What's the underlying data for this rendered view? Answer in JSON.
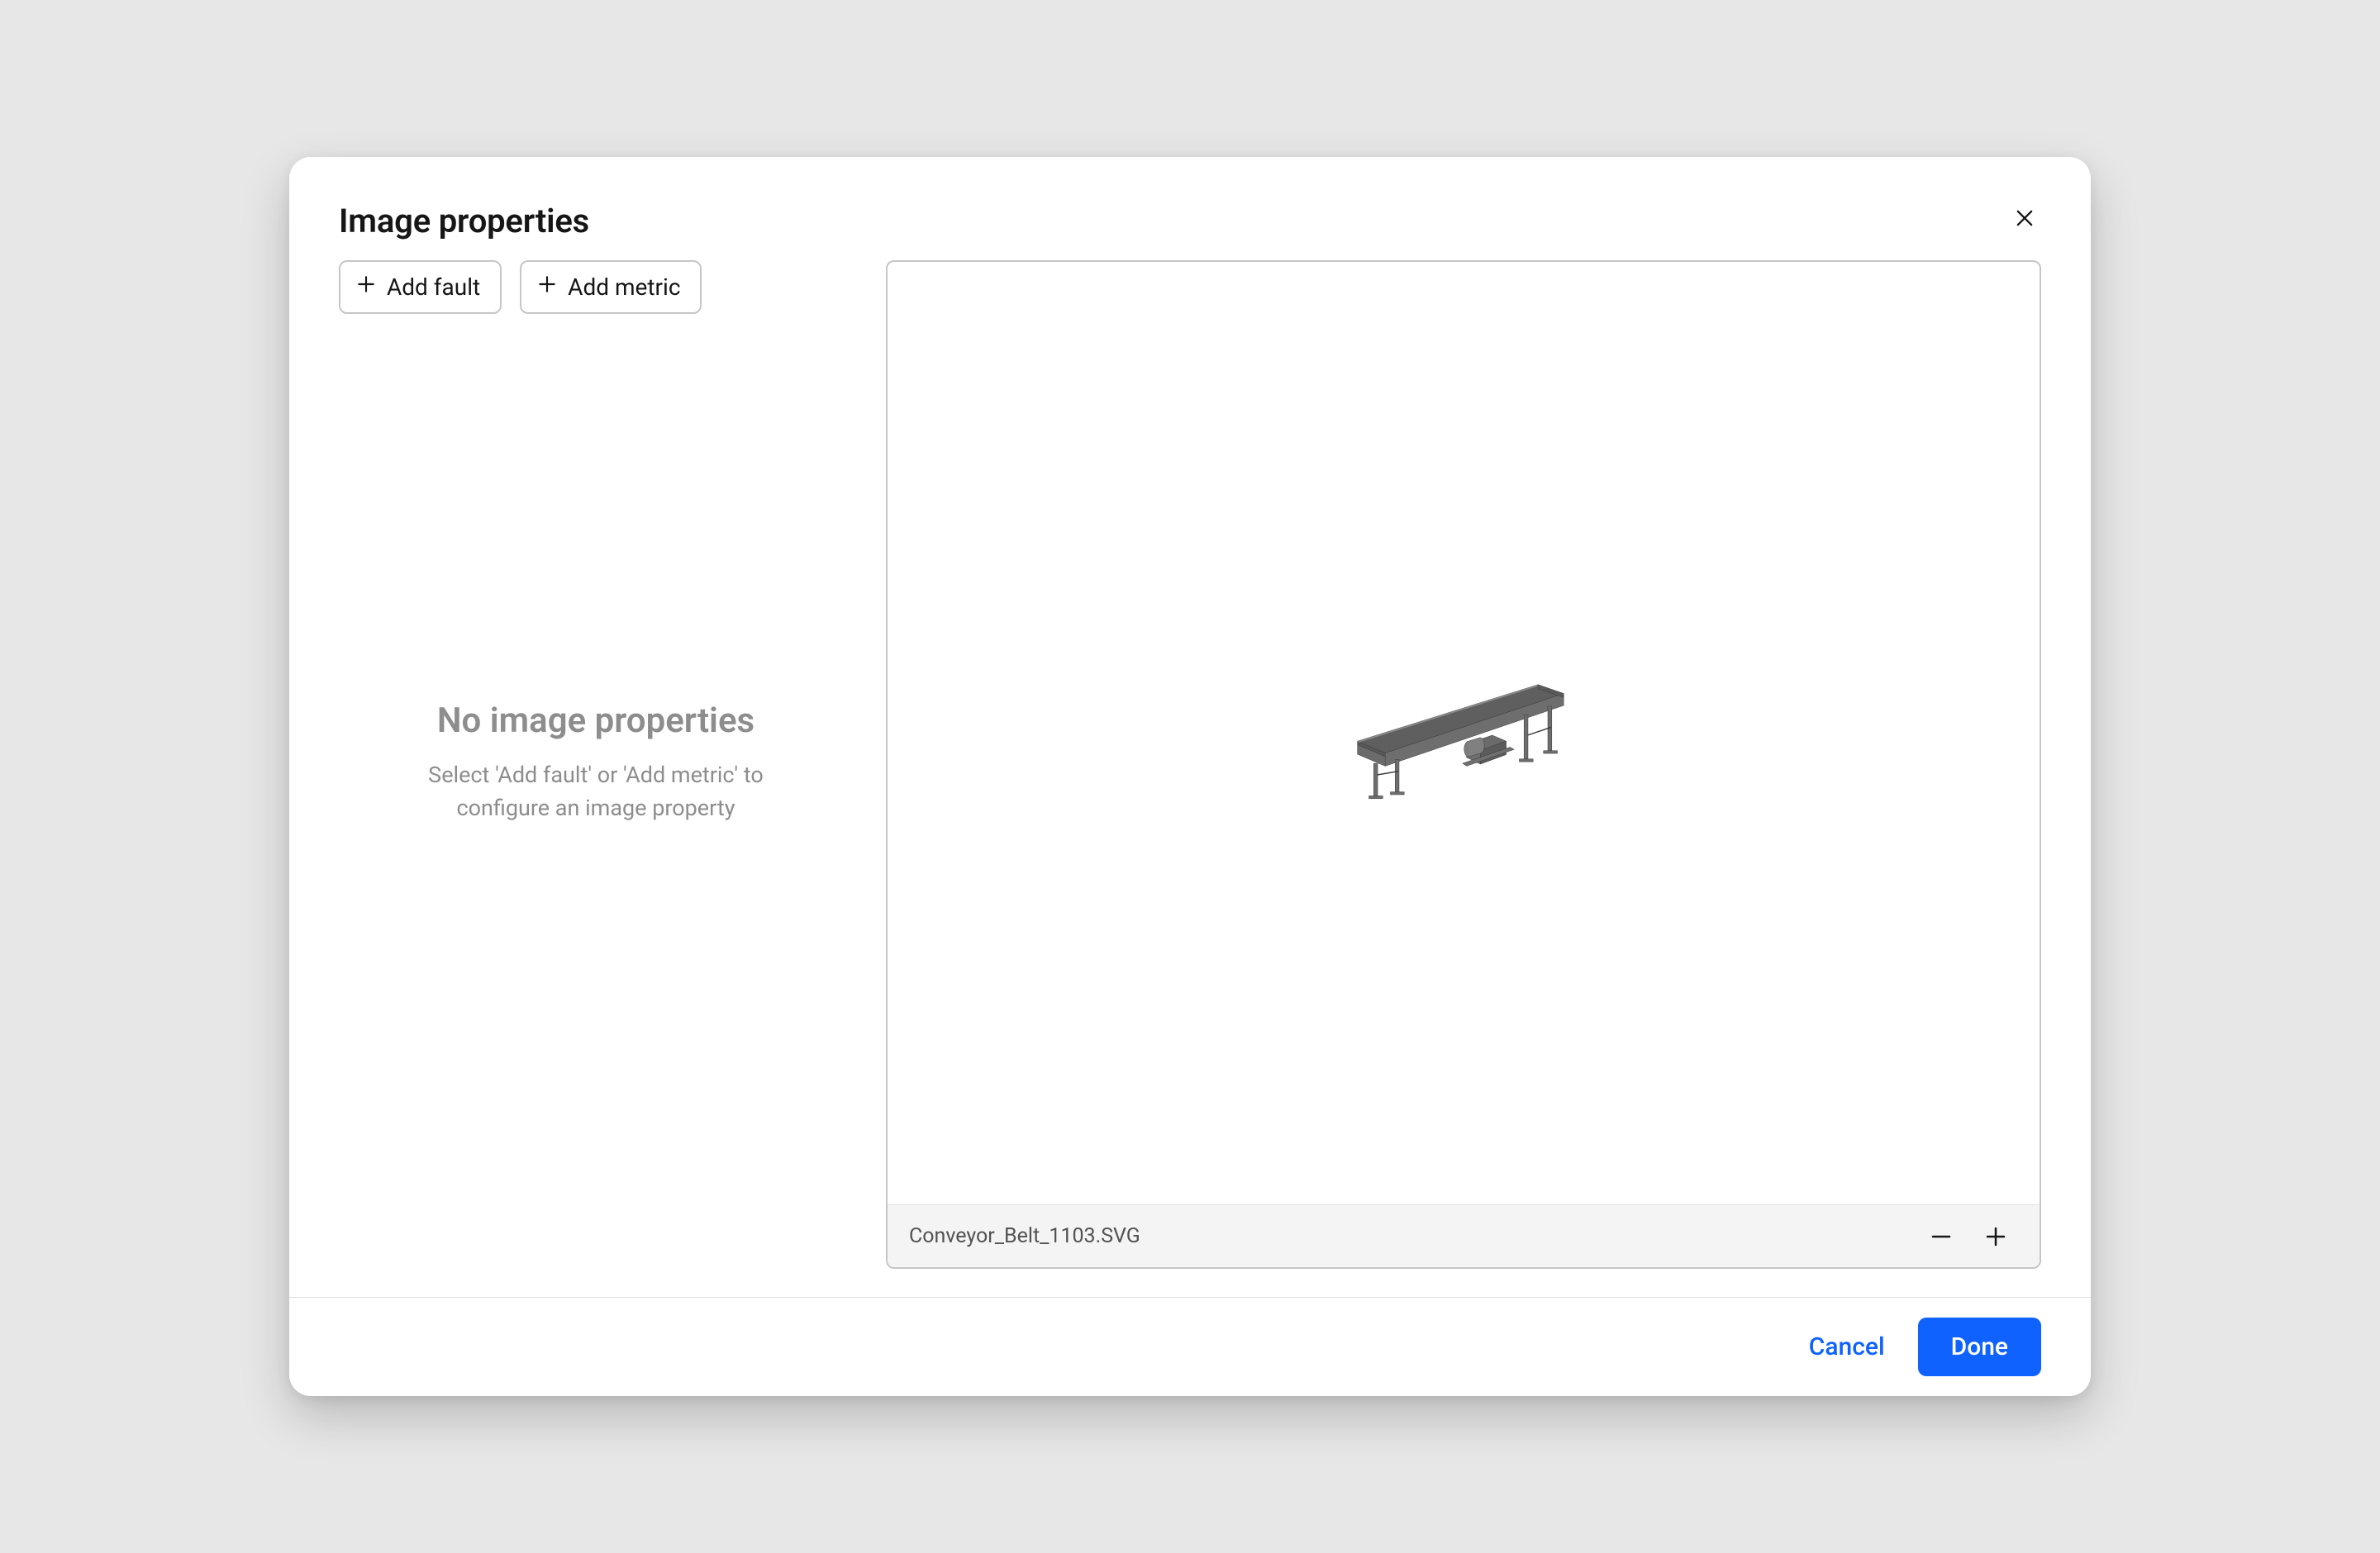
{
  "dialog": {
    "title": "Image properties"
  },
  "toolbar": {
    "add_fault_label": "Add fault",
    "add_metric_label": "Add metric"
  },
  "empty_state": {
    "title": "No image properties",
    "subtitle": "Select 'Add fault' or 'Add metric' to configure an image property"
  },
  "preview": {
    "filename": "Conveyor_Belt_1103.SVG"
  },
  "footer": {
    "cancel_label": "Cancel",
    "done_label": "Done"
  }
}
